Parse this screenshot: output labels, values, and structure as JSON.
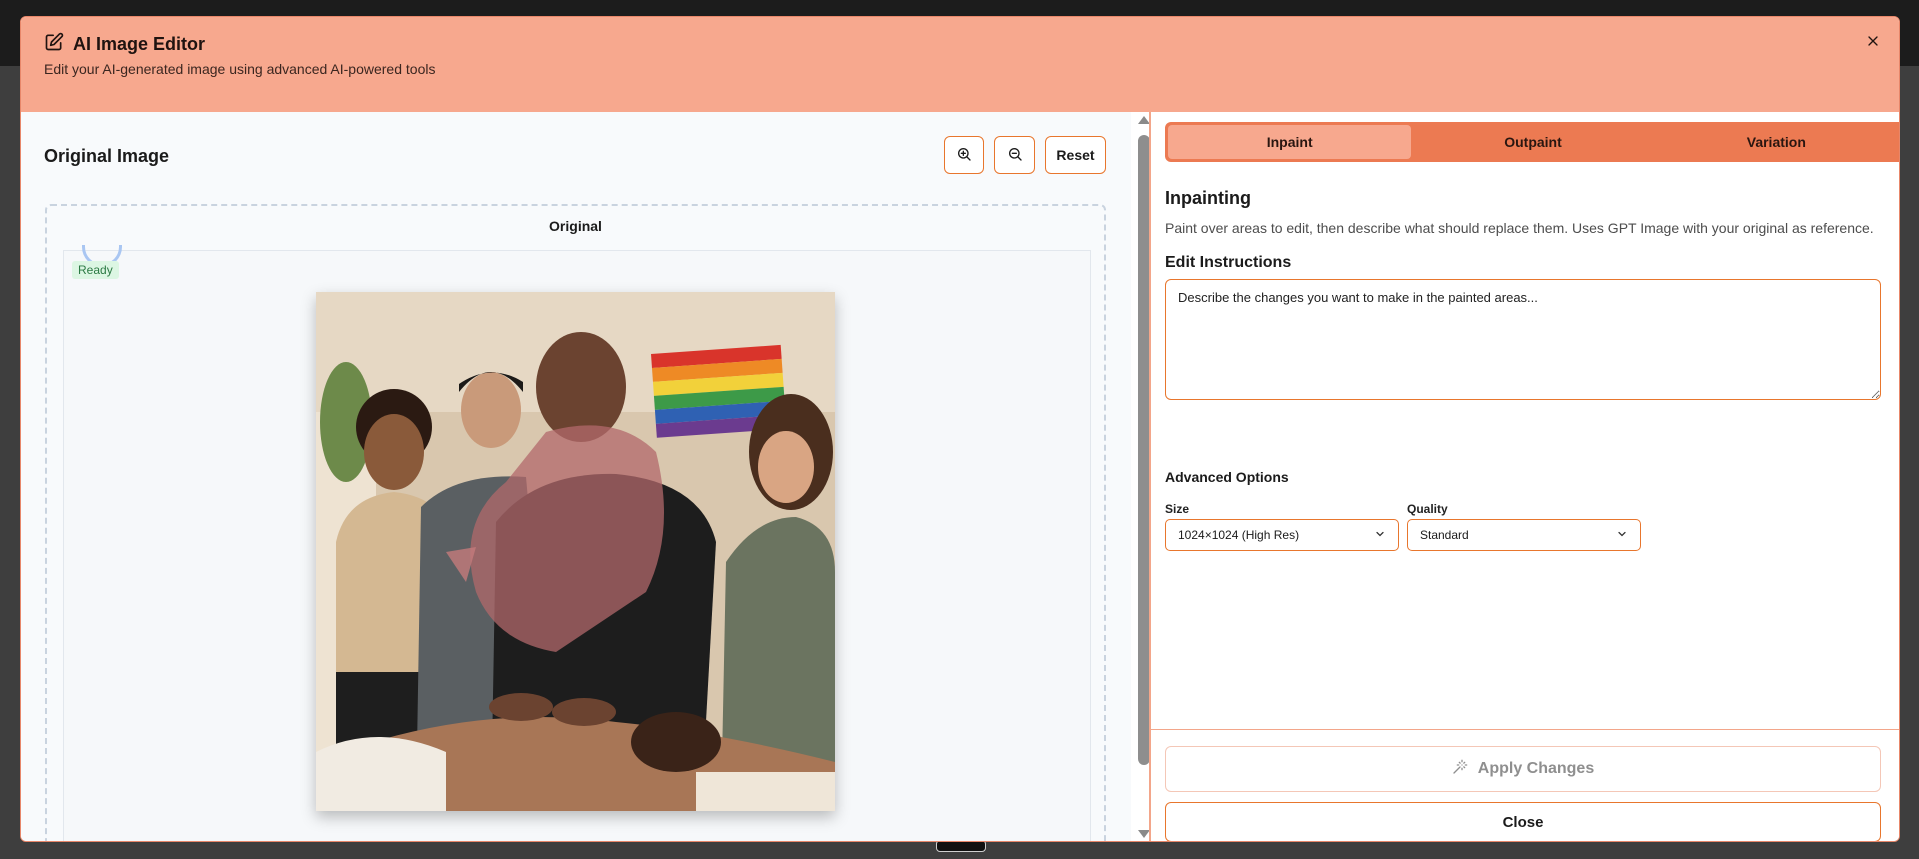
{
  "modal": {
    "title": "AI Image Editor",
    "subtitle": "Edit your AI-generated image using advanced AI-powered tools"
  },
  "left": {
    "title": "Original Image",
    "reset_label": "Reset",
    "frame_label": "Original",
    "status_badge": "Ready"
  },
  "tabs": [
    {
      "label": "Inpaint",
      "active": true
    },
    {
      "label": "Outpaint",
      "active": false
    },
    {
      "label": "Variation",
      "active": false
    }
  ],
  "inpaint": {
    "title": "Inpainting",
    "description": "Paint over areas to edit, then describe what should replace them. Uses GPT Image with your original as reference.",
    "edit_label": "Edit Instructions",
    "edit_placeholder": "Describe the changes you want to make in the painted areas...",
    "advanced_label": "Advanced Options",
    "size_label": "Size",
    "size_value": "1024×1024 (High Res)",
    "quality_label": "Quality",
    "quality_value": "Standard"
  },
  "footer": {
    "apply_label": "Apply Changes",
    "close_label": "Close"
  },
  "colors": {
    "header_bg": "#f7a88e",
    "accent": "#e8762d",
    "tab_bar": "#ec7a52",
    "ready_badge": "#dcf6e3"
  }
}
